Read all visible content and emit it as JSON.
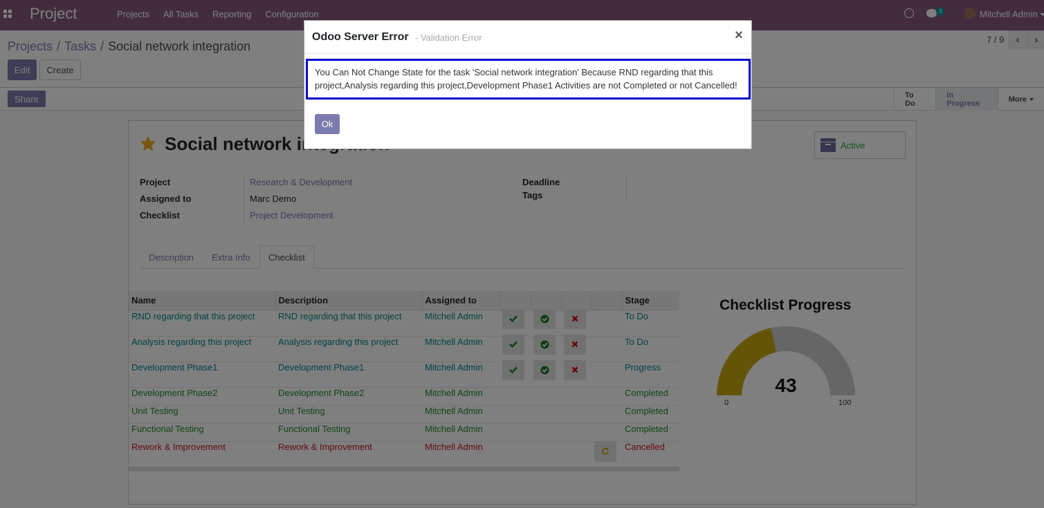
{
  "navbar": {
    "brand": "Project",
    "menu": [
      "Projects",
      "All Tasks",
      "Reporting",
      "Configuration"
    ],
    "chat_badge": "3",
    "user_name": "Mitchell Admin"
  },
  "breadcrumb": {
    "projects": "Projects",
    "tasks": "Tasks",
    "current": "Social network integration",
    "separator": "/"
  },
  "buttons": {
    "edit": "Edit",
    "create": "Create",
    "share": "Share"
  },
  "pager": {
    "text": "7 / 9"
  },
  "stages": {
    "todo": "To Do",
    "in_progress": "In Progress",
    "more": "More"
  },
  "task": {
    "title": "Social network integration",
    "active_label": "Active",
    "fields": {
      "project_label": "Project",
      "project_value": "Research & Development",
      "assigned_label": "Assigned to",
      "assigned_value": "Marc Demo",
      "checklist_label": "Checklist",
      "checklist_value": "Project Development",
      "deadline_label": "Deadline",
      "tags_label": "Tags"
    }
  },
  "tabs": [
    "Description",
    "Extra Info",
    "Checklist"
  ],
  "checklist_table": {
    "headers": [
      "Name",
      "Description",
      "Assigned to",
      "Stage"
    ],
    "rows": [
      {
        "name": "RND regarding that this project",
        "description": "RND regarding that this project",
        "assigned": "Mitchell Admin",
        "stage": "To Do"
      },
      {
        "name": "Analysis regarding this project",
        "description": "Analysis regarding this project",
        "assigned": "Mitchell Admin",
        "stage": "To Do"
      },
      {
        "name": "Development Phase1",
        "description": "Development Phase1",
        "assigned": "Mitchell Admin",
        "stage": "Progress"
      },
      {
        "name": "Development Phase2",
        "description": "Development Phase2",
        "assigned": "Mitchell Admin",
        "stage": "Completed"
      },
      {
        "name": "Unit Testing",
        "description": "Unit Testing",
        "assigned": "Mitchell Admin",
        "stage": "Completed"
      },
      {
        "name": "Functional Testing",
        "description": "Functional Testing",
        "assigned": "Mitchell Admin",
        "stage": "Completed"
      },
      {
        "name": "Rework & Improvement",
        "description": "Rework & Improvement",
        "assigned": "Mitchell Admin",
        "stage": "Cancelled"
      }
    ]
  },
  "gauge": {
    "title": "Checklist Progress",
    "value": "43",
    "min": "0",
    "max": "100",
    "fill_color": "#c9a90f",
    "track_color": "#cccccc"
  },
  "modal": {
    "title": "Odoo Server Error",
    "subtitle": "- Validation Error",
    "close": "×",
    "message": "You Can Not Change State for the task 'Social network integration' Because RND regarding that this project,Analysis regarding this project,Development Phase1 Activities are not Completed or not Cancelled!",
    "ok": "Ok"
  },
  "colors": {
    "navbar": "#875a7b",
    "primary": "#7c7bad",
    "error_border": "#0000cc"
  }
}
